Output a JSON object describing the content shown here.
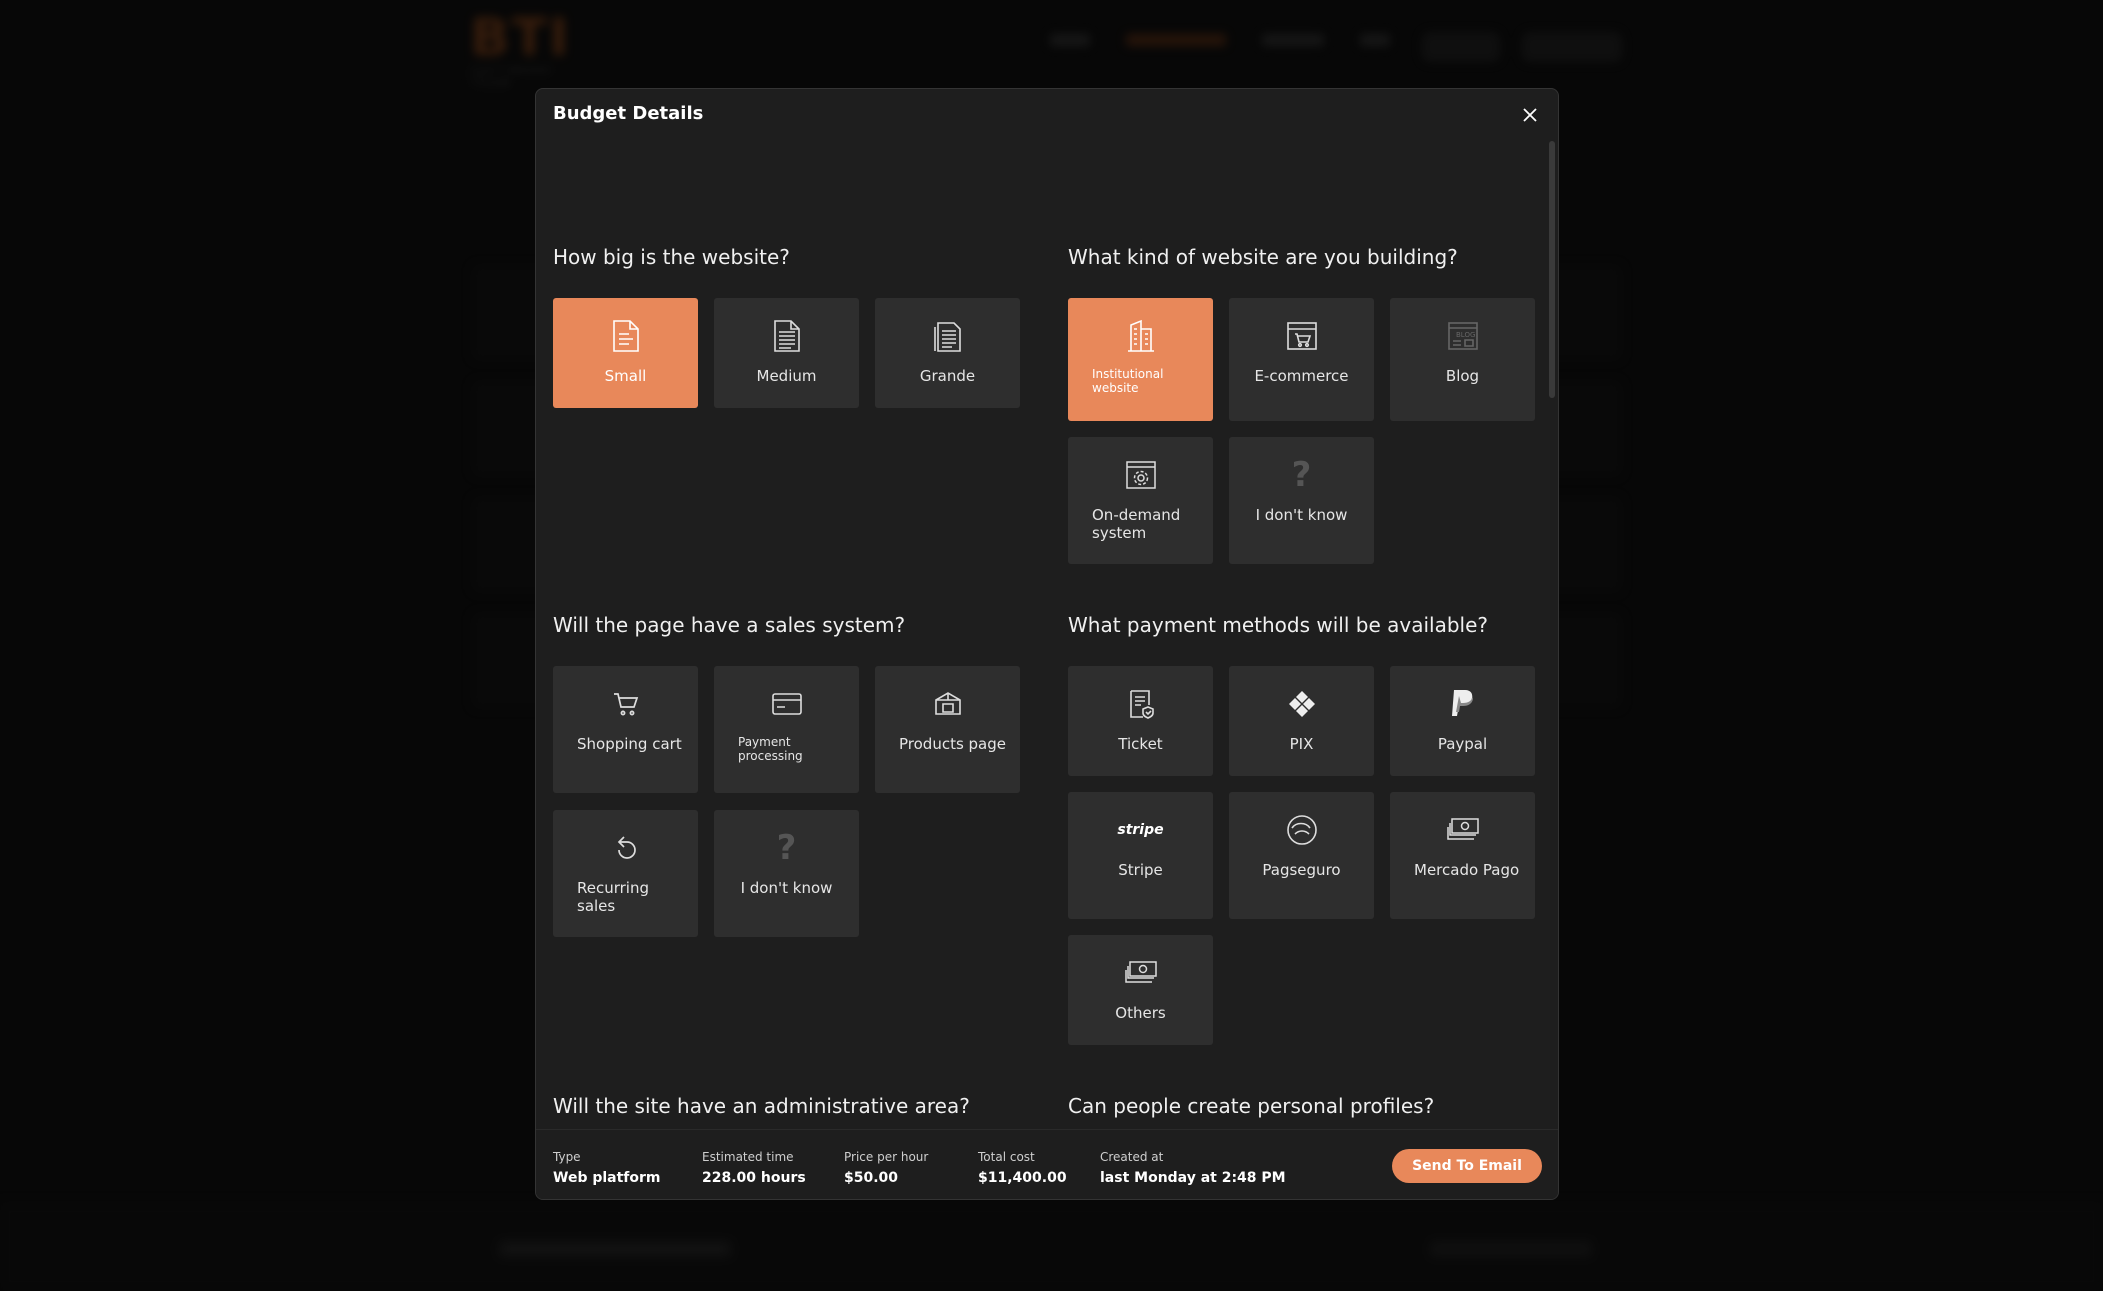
{
  "background": {
    "logo_text": "BTI",
    "logo_sub": "SOFTWARE TEAM"
  },
  "modal": {
    "title": "Budget Details",
    "sections": [
      {
        "question": "How big is the website?",
        "options": [
          {
            "label": "Small",
            "icon": "document-icon",
            "selected": true
          },
          {
            "label": "Medium",
            "icon": "document-lines-icon",
            "selected": false
          },
          {
            "label": "Grande",
            "icon": "documents-stack-icon",
            "selected": false
          }
        ]
      },
      {
        "question": "What kind of website are you building?",
        "options": [
          {
            "label": "Institutional website",
            "icon": "building-icon",
            "selected": true
          },
          {
            "label": "E-commerce",
            "icon": "shop-window-icon",
            "selected": false
          },
          {
            "label": "Blog",
            "icon": "blog-window-icon",
            "selected": false
          },
          {
            "label": "On-demand system",
            "icon": "settings-window-icon",
            "selected": false
          },
          {
            "label": "I don't know",
            "icon": "question-mark-icon",
            "selected": false
          }
        ]
      },
      {
        "question": "Will the page have a sales system?",
        "options": [
          {
            "label": "Shopping cart",
            "icon": "cart-icon",
            "selected": false
          },
          {
            "label": "Payment processing",
            "icon": "credit-card-icon",
            "selected": false
          },
          {
            "label": "Products page",
            "icon": "products-box-icon",
            "selected": false
          },
          {
            "label": "Recurring sales",
            "icon": "recurring-arrow-icon",
            "selected": false
          },
          {
            "label": "I don't know",
            "icon": "question-mark-icon",
            "selected": false
          }
        ]
      },
      {
        "question": "What payment methods will be available?",
        "options": [
          {
            "label": "Ticket",
            "icon": "ticket-icon",
            "selected": false
          },
          {
            "label": "PIX",
            "icon": "pix-icon",
            "selected": false
          },
          {
            "label": "Paypal",
            "icon": "paypal-icon",
            "selected": false
          },
          {
            "label": "Stripe",
            "icon": "stripe-icon",
            "icon_text": "stripe",
            "selected": false
          },
          {
            "label": "Pagseguro",
            "icon": "pagseguro-icon",
            "selected": false
          },
          {
            "label": "Mercado Pago",
            "icon": "cash-stack-icon",
            "selected": false
          },
          {
            "label": "Others",
            "icon": "cash-others-icon",
            "selected": false
          }
        ]
      },
      {
        "question": "Will the site have an administrative area?",
        "options": [
          {
            "label": "",
            "icon": "settings-wrench-icon",
            "selected": false
          },
          {
            "label": "",
            "icon": "admin-window-icon",
            "selected": true
          },
          {
            "label": "",
            "icon": "chat-lock-icon",
            "selected": false
          }
        ]
      },
      {
        "question": "Can people create personal profiles?",
        "options": [
          {
            "label": "",
            "icon": "check-icon",
            "selected": false
          },
          {
            "label": "",
            "icon": "question-mark-icon",
            "selected": false
          }
        ]
      }
    ],
    "footer": {
      "type_label": "Type",
      "type_value": "Web platform",
      "time_label": "Estimated time",
      "time_value": "228.00 hours",
      "price_label": "Price per hour",
      "price_value": "$50.00",
      "total_label": "Total cost",
      "total_value": "$11,400.00",
      "created_label": "Created at",
      "created_value": "last Monday at 2:48 PM",
      "send_label": "Send To Email"
    }
  },
  "colors": {
    "accent": "#e8885a",
    "card": "#2e2e2e",
    "modal_bg": "#1e1e1e",
    "page_bg": "#0d0d0d"
  }
}
